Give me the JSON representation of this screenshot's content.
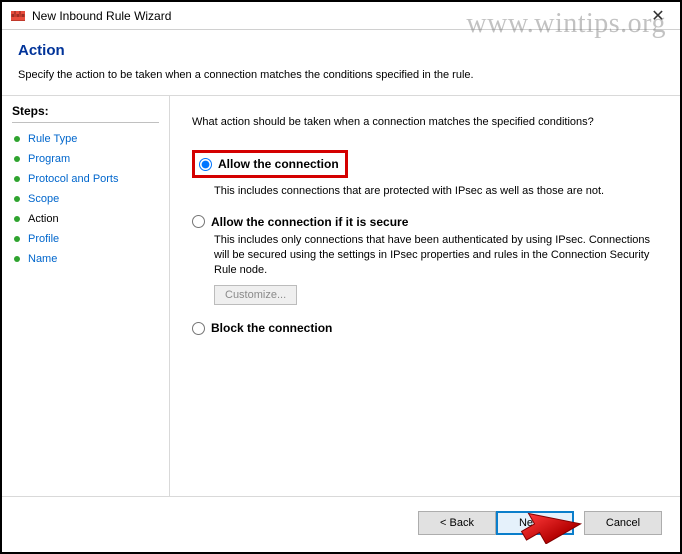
{
  "window": {
    "title": "New Inbound Rule Wizard"
  },
  "header": {
    "title": "Action",
    "subtitle": "Specify the action to be taken when a connection matches the conditions specified in the rule."
  },
  "steps": {
    "title": "Steps:",
    "items": [
      {
        "label": "Rule Type",
        "current": false
      },
      {
        "label": "Program",
        "current": false
      },
      {
        "label": "Protocol and Ports",
        "current": false
      },
      {
        "label": "Scope",
        "current": false
      },
      {
        "label": "Action",
        "current": true
      },
      {
        "label": "Profile",
        "current": false
      },
      {
        "label": "Name",
        "current": false
      }
    ]
  },
  "content": {
    "prompt": "What action should be taken when a connection matches the specified conditions?",
    "options": {
      "allow": {
        "label": "Allow the connection",
        "desc": "This includes connections that are protected with IPsec as well as those are not.",
        "selected": true
      },
      "allow_secure": {
        "label": "Allow the connection if it is secure",
        "desc": "This includes only connections that have been authenticated by using IPsec. Connections will be secured using the settings in IPsec properties and rules in the Connection Security Rule node.",
        "selected": false,
        "customize_label": "Customize..."
      },
      "block": {
        "label": "Block the connection",
        "selected": false
      }
    }
  },
  "buttons": {
    "back": "< Back",
    "next": "Next >",
    "cancel": "Cancel"
  },
  "watermark": "www.wintips.org"
}
